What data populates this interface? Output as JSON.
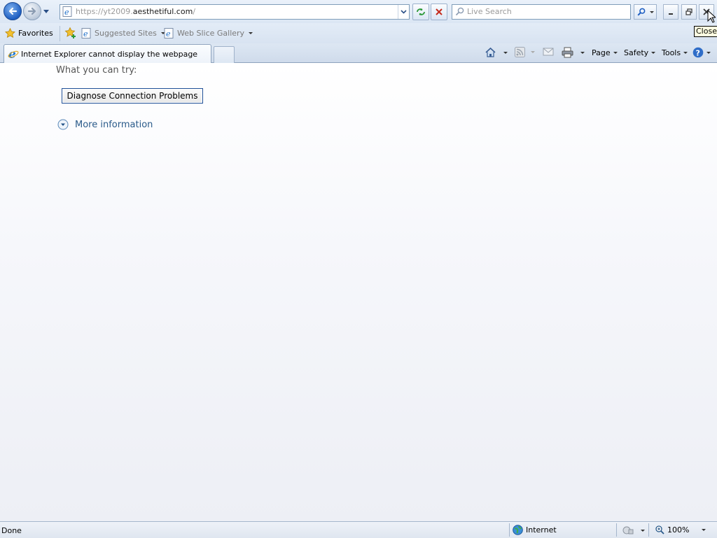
{
  "address": {
    "prefix": "https://yt2009.",
    "domain": "aesthetiful.com",
    "suffix": "/"
  },
  "search": {
    "placeholder": "Live Search"
  },
  "window": {
    "tooltip": "Close"
  },
  "favorites_bar": {
    "favorites_label": "Favorites",
    "items": [
      {
        "label": "Suggested Sites"
      },
      {
        "label": "Web Slice Gallery"
      }
    ]
  },
  "tabs": [
    {
      "title": "Internet Explorer cannot display the webpage"
    }
  ],
  "command_bar": {
    "page_label": "Page",
    "safety_label": "Safety",
    "tools_label": "Tools"
  },
  "content": {
    "try_label": "What you can try:",
    "diagnose_button": "Diagnose Connection Problems",
    "more_info": "More information"
  },
  "status": {
    "text": "Done",
    "zone": "Internet",
    "zoom": "100%"
  },
  "colors": {
    "accent": "#1f5fc2",
    "link": "#2a5a8a"
  }
}
